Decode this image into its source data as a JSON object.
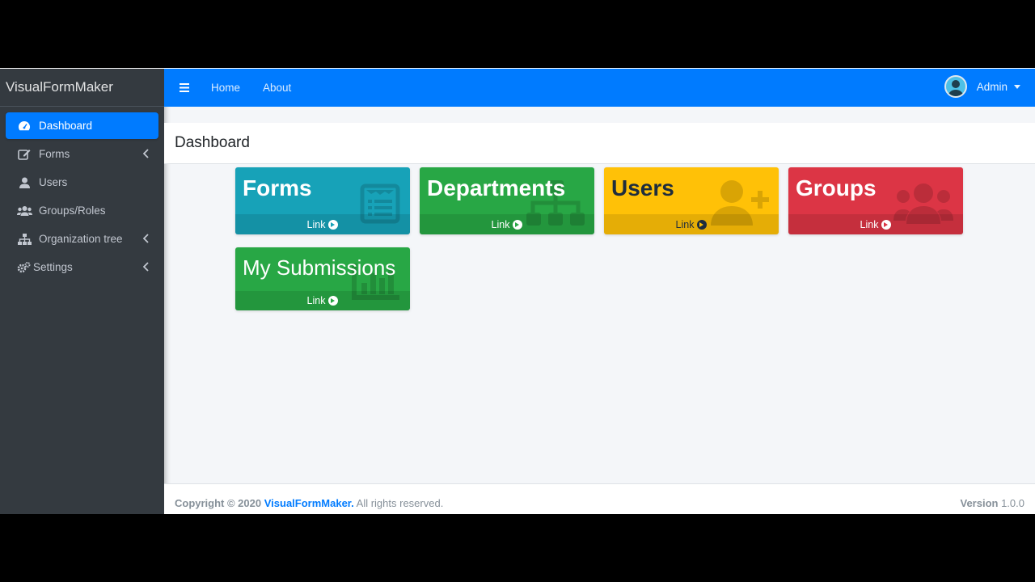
{
  "app": {
    "brand": "VisualFormMaker"
  },
  "sidebar": {
    "items": [
      {
        "label": "Dashboard",
        "icon": "tachometer-icon",
        "active": true
      },
      {
        "label": "Forms",
        "icon": "edit-icon"
      },
      {
        "label": "Users",
        "icon": "user-icon"
      },
      {
        "label": "Groups/Roles",
        "icon": "users-icon"
      },
      {
        "label": "Organization tree",
        "icon": "sitemap-icon"
      },
      {
        "label": "Settings",
        "icon": "cogs-icon"
      }
    ]
  },
  "header": {
    "nav": {
      "home": "Home",
      "about": "About"
    },
    "user": {
      "name": "Admin"
    }
  },
  "page": {
    "title": "Dashboard"
  },
  "boxes": [
    {
      "title": "Forms",
      "link": "Link",
      "color": "#17a2b8"
    },
    {
      "title": "Departments",
      "link": "Link",
      "color": "#28a745"
    },
    {
      "title": "Users",
      "link": "Link",
      "color": "#ffc107"
    },
    {
      "title": "Groups",
      "link": "Link",
      "color": "#dc3545"
    },
    {
      "title": "My Submissions",
      "link": "Link",
      "color": "#28a745"
    }
  ],
  "footer": {
    "copyright_prefix": "Copyright © 2020 ",
    "copyright_brand": "VisualFormMaker.",
    "copyright_suffix": " All rights reserved.",
    "version_label": "Version",
    "version_value": "1.0.0"
  },
  "colors": {
    "primary": "#007bff",
    "sidebar_bg": "#343a40"
  }
}
